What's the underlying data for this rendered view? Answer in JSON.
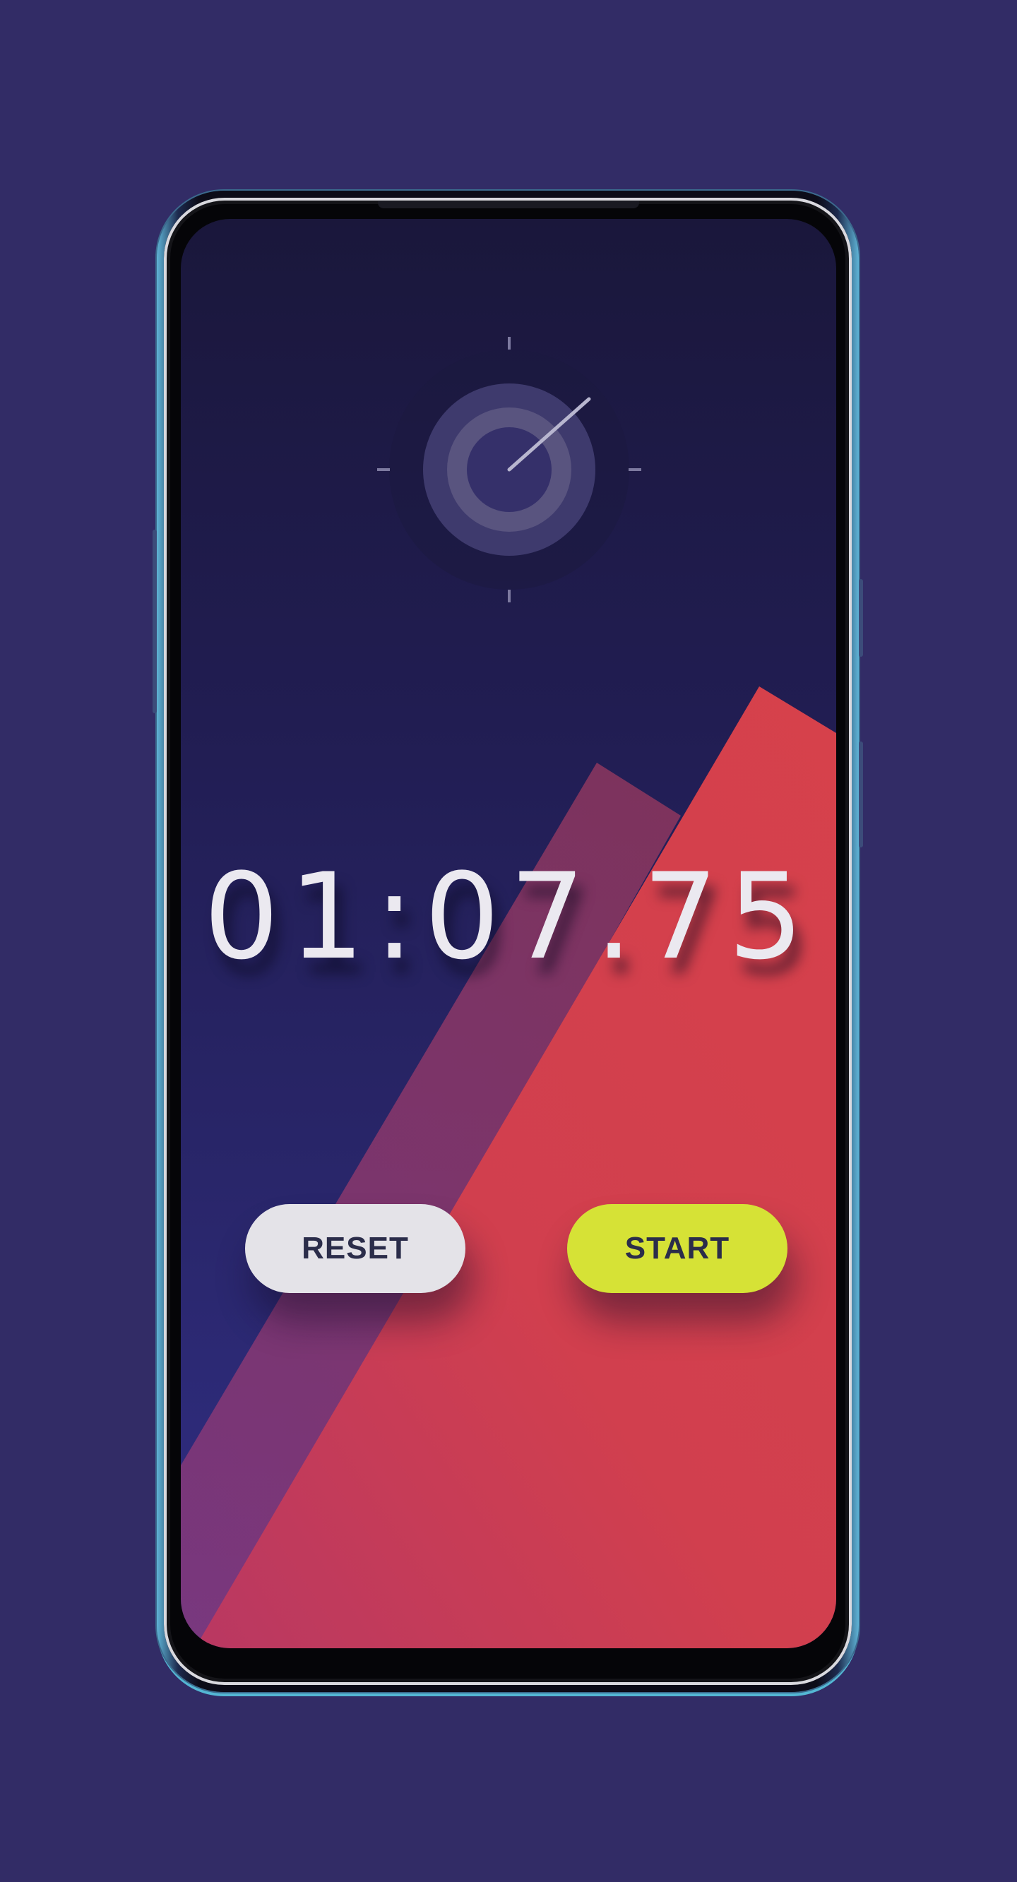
{
  "stopwatch": {
    "time": "01:07.75",
    "reset_label": "RESET",
    "start_label": "START"
  },
  "icons": {
    "clock": "stopwatch-dial-icon"
  },
  "colors": {
    "background": "#322c66",
    "screen_top": "#1a173b",
    "accent_red": "#d6404c",
    "start_button": "#d6e236",
    "reset_button": "#e4e3e8",
    "time_text": "#ebe9f0"
  }
}
